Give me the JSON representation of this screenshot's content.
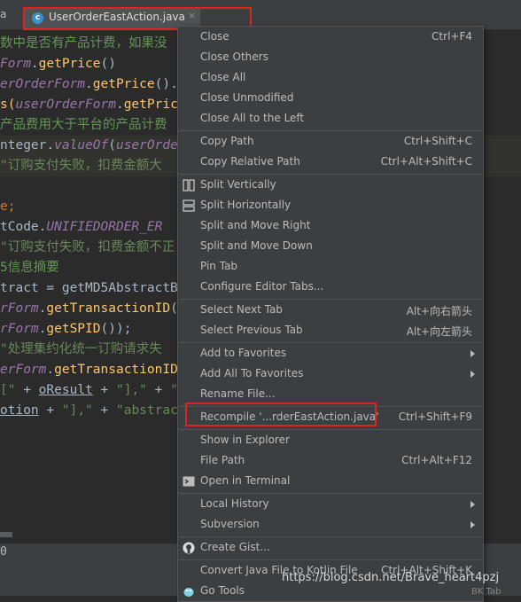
{
  "tabs": {
    "prev_tab_fragment": "a",
    "active_tab": "UserOrderEastAction.java",
    "active_tab_icon_letter": "c",
    "close_glyph": "×"
  },
  "code_lines": [
    {
      "segments": [
        {
          "t": "数中是否有产品计费，如果没",
          "c": "c-cmt"
        }
      ],
      "stripe": false
    },
    {
      "segments": [
        {
          "t": "Form",
          "c": "c-pur"
        },
        {
          "t": ".",
          "c": "c-def"
        },
        {
          "t": "getPrice",
          "c": "c-yel"
        },
        {
          "t": "()",
          "c": "c-def"
        }
      ],
      "stripe": false
    },
    {
      "segments": [
        {
          "t": "erOrderForm",
          "c": "c-pur"
        },
        {
          "t": ".",
          "c": "c-def"
        },
        {
          "t": "getPrice",
          "c": "c-yel"
        },
        {
          "t": "().",
          "c": "c-def"
        },
        {
          "t": "tri",
          "c": "c-yel"
        }
      ],
      "stripe": false
    },
    {
      "segments": [
        {
          "t": "s(",
          "c": "c-yel"
        },
        {
          "t": "userOrderForm",
          "c": "c-pur"
        },
        {
          "t": ".",
          "c": "c-def"
        },
        {
          "t": "getPrice",
          "c": "c-yel"
        },
        {
          "t": "()",
          "c": "c-def"
        }
      ],
      "stripe": false
    },
    {
      "segments": [
        {
          "t": "产品费用大于平台的产品计费",
          "c": "c-cmt"
        }
      ],
      "stripe": false
    },
    {
      "segments": [
        {
          "t": "nteger",
          "c": "c-def"
        },
        {
          "t": ".",
          "c": "c-def"
        },
        {
          "t": "valueOf",
          "c": "c-pur"
        },
        {
          "t": "(",
          "c": "c-def"
        },
        {
          "t": "userOrderFo",
          "c": "c-pur"
        }
      ],
      "stripe": true
    },
    {
      "segments": [
        {
          "t": "\"订购支付失败，扣费金额大",
          "c": "c-str"
        }
      ],
      "stripe": true
    },
    {
      "segments": [
        {
          "t": "",
          "c": "c-def"
        }
      ],
      "stripe": false
    },
    {
      "segments": [
        {
          "t": "e;",
          "c": "c-ora"
        }
      ],
      "stripe": false
    },
    {
      "segments": [
        {
          "t": "tCode.",
          "c": "c-def"
        },
        {
          "t": "UNIFIEDORDER_ER",
          "c": "c-pur"
        }
      ],
      "stripe": false
    },
    {
      "segments": [
        {
          "t": "\"订购支付失败，扣费金额不正",
          "c": "c-str"
        }
      ],
      "stripe": false
    },
    {
      "segments": [
        {
          "t": "5信息摘要",
          "c": "c-cmt"
        }
      ],
      "stripe": false
    },
    {
      "segments": [
        {
          "t": "tract = getMD5AbstractByK",
          "c": "c-def"
        }
      ],
      "stripe": false
    },
    {
      "segments": [
        {
          "t": "rForm",
          "c": "c-pur"
        },
        {
          "t": ".",
          "c": "c-def"
        },
        {
          "t": "getTransactionID",
          "c": "c-yel"
        },
        {
          "t": "(), ",
          "c": "c-def"
        },
        {
          "t": "o",
          "c": "c-und c-def"
        }
      ],
      "stripe": false
    },
    {
      "segments": [
        {
          "t": "rForm",
          "c": "c-pur"
        },
        {
          "t": ".",
          "c": "c-def"
        },
        {
          "t": "getSPID",
          "c": "c-yel"
        },
        {
          "t": "());",
          "c": "c-def"
        }
      ],
      "stripe": false
    },
    {
      "segments": [
        {
          "t": "\"处理集约化统一订购请求失",
          "c": "c-str"
        }
      ],
      "stripe": false
    },
    {
      "segments": [
        {
          "t": "erForm",
          "c": "c-pur"
        },
        {
          "t": ".",
          "c": "c-def"
        },
        {
          "t": "getTransactionID",
          "c": "c-yel"
        },
        {
          "t": "()",
          "c": "c-def"
        }
      ],
      "stripe": false
    },
    {
      "segments": [
        {
          "t": "[\"",
          "c": "c-str"
        },
        {
          "t": " + ",
          "c": "c-def"
        },
        {
          "t": "oResult",
          "c": "c-und c-def"
        },
        {
          "t": " + ",
          "c": "c-def"
        },
        {
          "t": "\"],\"",
          "c": "c-str"
        },
        {
          "t": " + ",
          "c": "c-def"
        },
        {
          "t": "\"descri",
          "c": "c-str"
        }
      ],
      "stripe": false
    },
    {
      "segments": [
        {
          "t": "otion",
          "c": "c-und c-def"
        },
        {
          "t": " + ",
          "c": "c-def"
        },
        {
          "t": "\"],\"",
          "c": "c-str"
        },
        {
          "t": " + ",
          "c": "c-def"
        },
        {
          "t": "\"abstract=[\"",
          "c": "c-str"
        },
        {
          "t": " + ",
          "c": "c-def"
        }
      ],
      "stripe": false
    }
  ],
  "status_line_text": "0",
  "menu": {
    "items": [
      {
        "label": "Close",
        "shortcut": "Ctrl+F4",
        "submenu": false,
        "icon": ""
      },
      {
        "label": "Close Others",
        "shortcut": "",
        "submenu": false,
        "icon": ""
      },
      {
        "label": "Close All",
        "shortcut": "",
        "submenu": false,
        "icon": ""
      },
      {
        "label": "Close Unmodified",
        "shortcut": "",
        "submenu": false,
        "icon": ""
      },
      {
        "label": "Close All to the Left",
        "shortcut": "",
        "submenu": false,
        "icon": ""
      },
      {
        "sep": true
      },
      {
        "label": "Copy Path",
        "shortcut": "Ctrl+Shift+C",
        "submenu": false,
        "icon": ""
      },
      {
        "label": "Copy Relative Path",
        "shortcut": "Ctrl+Alt+Shift+C",
        "submenu": false,
        "icon": ""
      },
      {
        "sep": true
      },
      {
        "label": "Split Vertically",
        "shortcut": "",
        "submenu": false,
        "icon": "split-vertical-icon"
      },
      {
        "label": "Split Horizontally",
        "shortcut": "",
        "submenu": false,
        "icon": "split-horizontal-icon"
      },
      {
        "label": "Split and Move Right",
        "shortcut": "",
        "submenu": false,
        "icon": ""
      },
      {
        "label": "Split and Move Down",
        "shortcut": "",
        "submenu": false,
        "icon": ""
      },
      {
        "label": "Pin Tab",
        "shortcut": "",
        "submenu": false,
        "icon": ""
      },
      {
        "label": "Configure Editor Tabs...",
        "shortcut": "",
        "submenu": false,
        "icon": ""
      },
      {
        "sep": true
      },
      {
        "label": "Select Next Tab",
        "shortcut": "Alt+向右箭头",
        "submenu": false,
        "icon": ""
      },
      {
        "label": "Select Previous Tab",
        "shortcut": "Alt+向左箭头",
        "submenu": false,
        "icon": ""
      },
      {
        "sep": true
      },
      {
        "label": "Add to Favorites",
        "shortcut": "",
        "submenu": true,
        "icon": ""
      },
      {
        "label": "Add All To Favorites",
        "shortcut": "",
        "submenu": true,
        "icon": ""
      },
      {
        "label": "Rename File...",
        "shortcut": "",
        "submenu": false,
        "icon": ""
      },
      {
        "sep": true
      },
      {
        "label": "Recompile '...rderEastAction.java'",
        "shortcut": "Ctrl+Shift+F9",
        "submenu": false,
        "icon": "",
        "highlight": true
      },
      {
        "sep": true
      },
      {
        "label": "Show in Explorer",
        "shortcut": "",
        "submenu": false,
        "icon": ""
      },
      {
        "label": "File Path",
        "shortcut": "Ctrl+Alt+F12",
        "submenu": false,
        "icon": ""
      },
      {
        "label": "Open in Terminal",
        "shortcut": "",
        "submenu": false,
        "icon": "terminal-icon"
      },
      {
        "sep": true
      },
      {
        "label": "Local History",
        "shortcut": "",
        "submenu": true,
        "icon": ""
      },
      {
        "label": "Subversion",
        "shortcut": "",
        "submenu": true,
        "icon": ""
      },
      {
        "sep": true
      },
      {
        "label": "Create Gist...",
        "shortcut": "",
        "submenu": false,
        "icon": "github-icon"
      },
      {
        "sep": true
      },
      {
        "label": "Convert Java File to Kotlin File",
        "shortcut": "Ctrl+Alt+Shift+K",
        "submenu": false,
        "icon": ""
      },
      {
        "label": "Go Tools",
        "shortcut": "",
        "submenu": false,
        "icon": "go-icon"
      }
    ]
  },
  "watermark": "https://blog.csdn.net/Brave_heart4pzj",
  "watermark_trailing": "BK  Tab"
}
